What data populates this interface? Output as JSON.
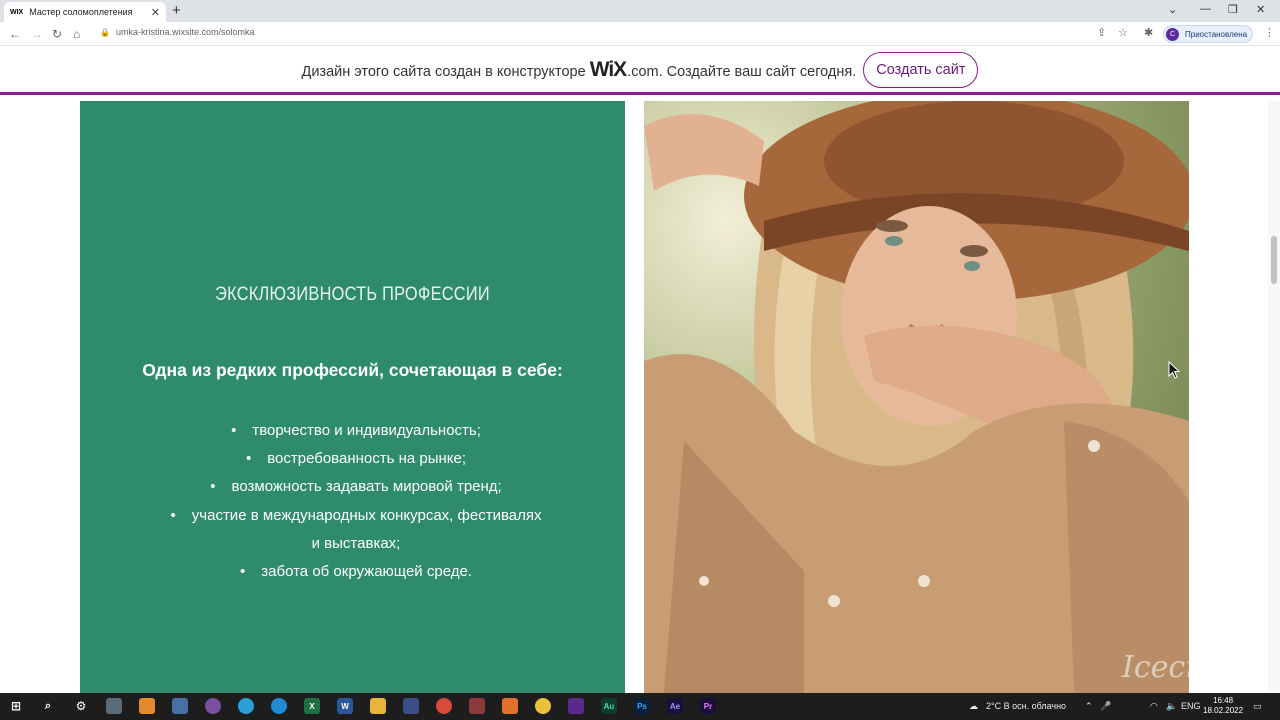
{
  "browser": {
    "tab_title": "Мастер соломоплетения",
    "tab_favicon": "WIX",
    "url": "umka-kristina.wixsite.com/solomka",
    "profile_label": "Приостановлена",
    "profile_initial": "С"
  },
  "wix_banner": {
    "text_before": "Дизайн этого сайта создан в конструкторе",
    "logo": "WiX",
    "logo_suffix": ".com.",
    "text_after": "Создайте ваш сайт сегодня.",
    "button_label": "Создать сайт"
  },
  "section": {
    "title": "ЭКСКЛЮЗИВНОСТЬ ПРОФЕССИИ",
    "lead": "Одна из редких профессий, сочетающая в себе:",
    "bullets": [
      "творчество и индивидуальность;",
      "востребованность на рынке;",
      "возможность задавать мировой тренд;",
      "участие в международных конкурсах, фестивалях",
      "и выставках;",
      "забота об окружающей среде."
    ],
    "green_color": "#2e8b6e"
  },
  "taskbar": {
    "weather": "2°C  В осн. облачно",
    "language": "ENG",
    "time": "16:48",
    "date": "18.02.2022",
    "watermark": "Icecream"
  }
}
